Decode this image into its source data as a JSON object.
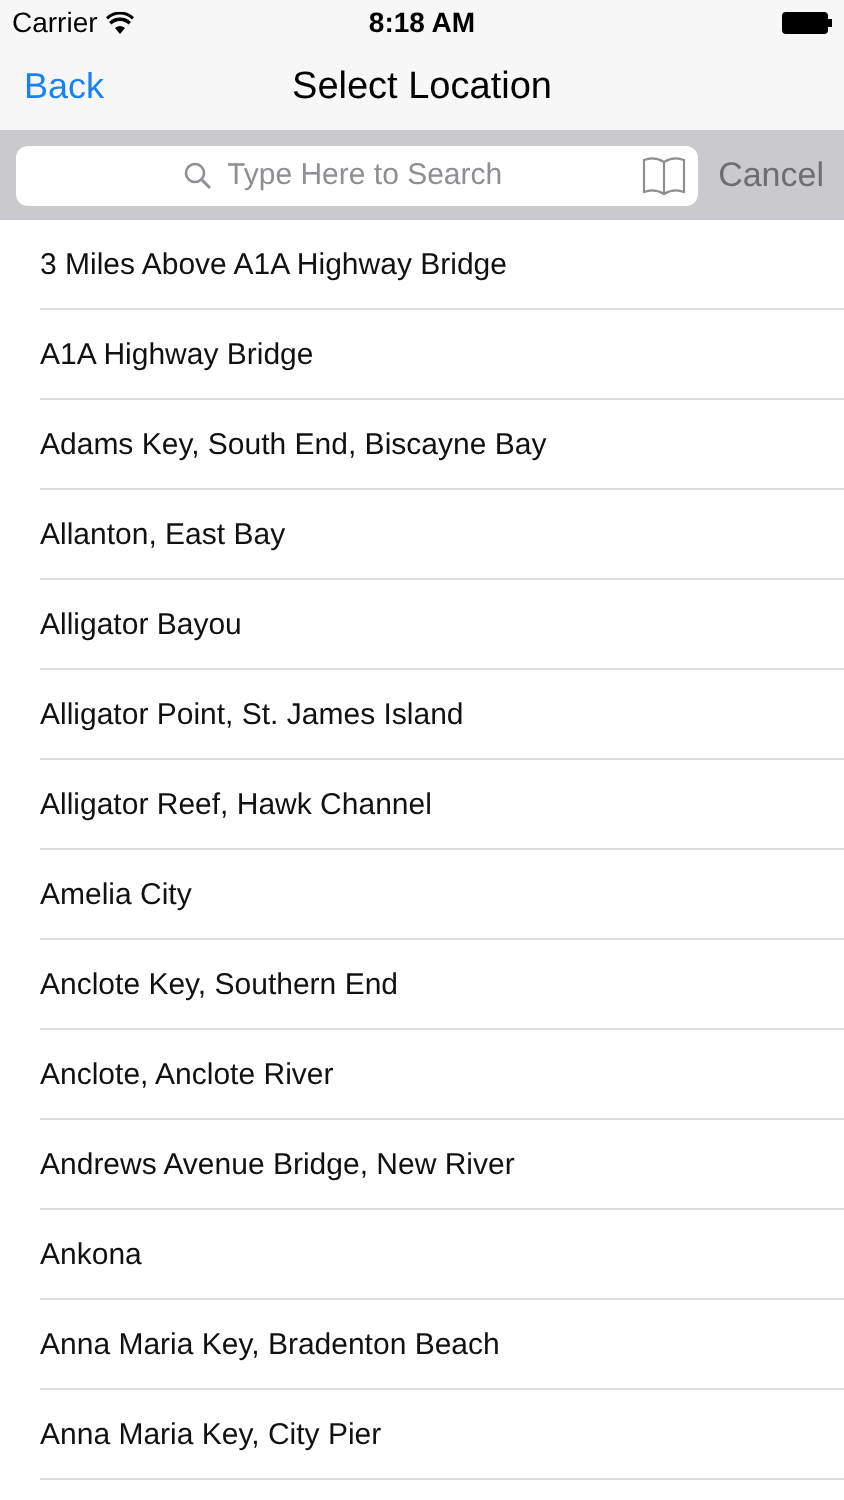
{
  "status_bar": {
    "carrier": "Carrier",
    "time": "8:18 AM"
  },
  "nav_bar": {
    "back": "Back",
    "title": "Select Location"
  },
  "search": {
    "placeholder": "Type Here to Search",
    "cancel": "Cancel",
    "cancel_disabled": true
  },
  "locations": [
    "3 Miles Above A1A Highway Bridge",
    "A1A Highway Bridge",
    "Adams Key, South End, Biscayne Bay",
    "Allanton, East Bay",
    "Alligator Bayou",
    "Alligator Point, St. James Island",
    "Alligator Reef, Hawk Channel",
    "Amelia City",
    "Anclote Key, Southern End",
    "Anclote, Anclote River",
    "Andrews Avenue Bridge, New River",
    "Ankona",
    "Anna Maria Key, Bradenton Beach",
    "Anna Maria Key, City Pier"
  ]
}
